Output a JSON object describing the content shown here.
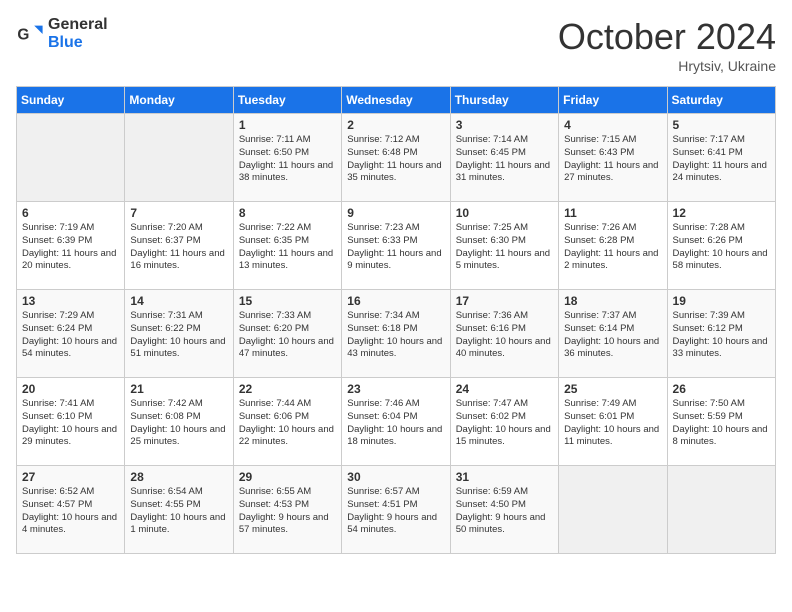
{
  "logo": {
    "general": "General",
    "blue": "Blue"
  },
  "header": {
    "month": "October 2024",
    "location": "Hrytsiv, Ukraine"
  },
  "days_of_week": [
    "Sunday",
    "Monday",
    "Tuesday",
    "Wednesday",
    "Thursday",
    "Friday",
    "Saturday"
  ],
  "weeks": [
    [
      {
        "day": "",
        "info": ""
      },
      {
        "day": "",
        "info": ""
      },
      {
        "day": "1",
        "info": "Sunrise: 7:11 AM\nSunset: 6:50 PM\nDaylight: 11 hours and 38 minutes."
      },
      {
        "day": "2",
        "info": "Sunrise: 7:12 AM\nSunset: 6:48 PM\nDaylight: 11 hours and 35 minutes."
      },
      {
        "day": "3",
        "info": "Sunrise: 7:14 AM\nSunset: 6:45 PM\nDaylight: 11 hours and 31 minutes."
      },
      {
        "day": "4",
        "info": "Sunrise: 7:15 AM\nSunset: 6:43 PM\nDaylight: 11 hours and 27 minutes."
      },
      {
        "day": "5",
        "info": "Sunrise: 7:17 AM\nSunset: 6:41 PM\nDaylight: 11 hours and 24 minutes."
      }
    ],
    [
      {
        "day": "6",
        "info": "Sunrise: 7:19 AM\nSunset: 6:39 PM\nDaylight: 11 hours and 20 minutes."
      },
      {
        "day": "7",
        "info": "Sunrise: 7:20 AM\nSunset: 6:37 PM\nDaylight: 11 hours and 16 minutes."
      },
      {
        "day": "8",
        "info": "Sunrise: 7:22 AM\nSunset: 6:35 PM\nDaylight: 11 hours and 13 minutes."
      },
      {
        "day": "9",
        "info": "Sunrise: 7:23 AM\nSunset: 6:33 PM\nDaylight: 11 hours and 9 minutes."
      },
      {
        "day": "10",
        "info": "Sunrise: 7:25 AM\nSunset: 6:30 PM\nDaylight: 11 hours and 5 minutes."
      },
      {
        "day": "11",
        "info": "Sunrise: 7:26 AM\nSunset: 6:28 PM\nDaylight: 11 hours and 2 minutes."
      },
      {
        "day": "12",
        "info": "Sunrise: 7:28 AM\nSunset: 6:26 PM\nDaylight: 10 hours and 58 minutes."
      }
    ],
    [
      {
        "day": "13",
        "info": "Sunrise: 7:29 AM\nSunset: 6:24 PM\nDaylight: 10 hours and 54 minutes."
      },
      {
        "day": "14",
        "info": "Sunrise: 7:31 AM\nSunset: 6:22 PM\nDaylight: 10 hours and 51 minutes."
      },
      {
        "day": "15",
        "info": "Sunrise: 7:33 AM\nSunset: 6:20 PM\nDaylight: 10 hours and 47 minutes."
      },
      {
        "day": "16",
        "info": "Sunrise: 7:34 AM\nSunset: 6:18 PM\nDaylight: 10 hours and 43 minutes."
      },
      {
        "day": "17",
        "info": "Sunrise: 7:36 AM\nSunset: 6:16 PM\nDaylight: 10 hours and 40 minutes."
      },
      {
        "day": "18",
        "info": "Sunrise: 7:37 AM\nSunset: 6:14 PM\nDaylight: 10 hours and 36 minutes."
      },
      {
        "day": "19",
        "info": "Sunrise: 7:39 AM\nSunset: 6:12 PM\nDaylight: 10 hours and 33 minutes."
      }
    ],
    [
      {
        "day": "20",
        "info": "Sunrise: 7:41 AM\nSunset: 6:10 PM\nDaylight: 10 hours and 29 minutes."
      },
      {
        "day": "21",
        "info": "Sunrise: 7:42 AM\nSunset: 6:08 PM\nDaylight: 10 hours and 25 minutes."
      },
      {
        "day": "22",
        "info": "Sunrise: 7:44 AM\nSunset: 6:06 PM\nDaylight: 10 hours and 22 minutes."
      },
      {
        "day": "23",
        "info": "Sunrise: 7:46 AM\nSunset: 6:04 PM\nDaylight: 10 hours and 18 minutes."
      },
      {
        "day": "24",
        "info": "Sunrise: 7:47 AM\nSunset: 6:02 PM\nDaylight: 10 hours and 15 minutes."
      },
      {
        "day": "25",
        "info": "Sunrise: 7:49 AM\nSunset: 6:01 PM\nDaylight: 10 hours and 11 minutes."
      },
      {
        "day": "26",
        "info": "Sunrise: 7:50 AM\nSunset: 5:59 PM\nDaylight: 10 hours and 8 minutes."
      }
    ],
    [
      {
        "day": "27",
        "info": "Sunrise: 6:52 AM\nSunset: 4:57 PM\nDaylight: 10 hours and 4 minutes."
      },
      {
        "day": "28",
        "info": "Sunrise: 6:54 AM\nSunset: 4:55 PM\nDaylight: 10 hours and 1 minute."
      },
      {
        "day": "29",
        "info": "Sunrise: 6:55 AM\nSunset: 4:53 PM\nDaylight: 9 hours and 57 minutes."
      },
      {
        "day": "30",
        "info": "Sunrise: 6:57 AM\nSunset: 4:51 PM\nDaylight: 9 hours and 54 minutes."
      },
      {
        "day": "31",
        "info": "Sunrise: 6:59 AM\nSunset: 4:50 PM\nDaylight: 9 hours and 50 minutes."
      },
      {
        "day": "",
        "info": ""
      },
      {
        "day": "",
        "info": ""
      }
    ]
  ]
}
